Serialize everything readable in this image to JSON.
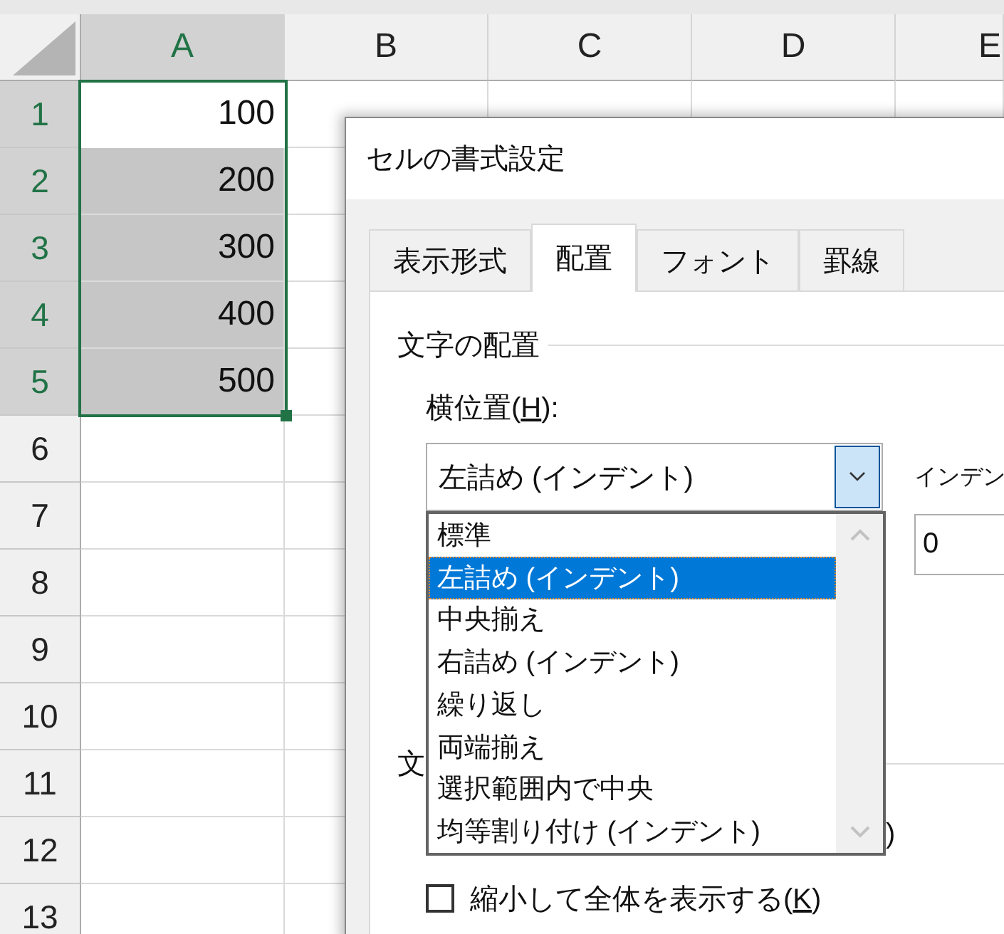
{
  "sheet": {
    "columns": [
      {
        "label": "A",
        "selected": true
      },
      {
        "label": "B",
        "selected": false
      },
      {
        "label": "C",
        "selected": false
      },
      {
        "label": "D",
        "selected": false
      },
      {
        "label": "E",
        "selected": false
      }
    ],
    "rows": [
      {
        "label": "1",
        "selected": true,
        "active": true,
        "cell_a": "100"
      },
      {
        "label": "2",
        "selected": true,
        "active": false,
        "cell_a": "200"
      },
      {
        "label": "3",
        "selected": true,
        "active": false,
        "cell_a": "300"
      },
      {
        "label": "4",
        "selected": true,
        "active": false,
        "cell_a": "400"
      },
      {
        "label": "5",
        "selected": true,
        "active": false,
        "cell_a": "500"
      },
      {
        "label": "6",
        "selected": false
      },
      {
        "label": "7",
        "selected": false
      },
      {
        "label": "8",
        "selected": false
      },
      {
        "label": "9",
        "selected": false
      },
      {
        "label": "10",
        "selected": false
      },
      {
        "label": "11",
        "selected": false
      },
      {
        "label": "12",
        "selected": false
      },
      {
        "label": "13",
        "selected": false
      }
    ]
  },
  "dialog": {
    "title": "セルの書式設定",
    "tabs": [
      {
        "label": "表示形式",
        "selected": false
      },
      {
        "label": "配置",
        "selected": true
      },
      {
        "label": "フォント",
        "selected": false
      },
      {
        "label": "罫線",
        "selected": false
      }
    ],
    "text_alignment": {
      "group_label": "文字の配置",
      "horizontal": {
        "label_before": "横位置(",
        "access_key": "H",
        "label_after": "):",
        "value": "左詰め (インデント)",
        "expanded": true,
        "options": [
          {
            "label": "標準",
            "selected": false
          },
          {
            "label": "左詰め (インデント)",
            "selected": true
          },
          {
            "label": "中央揃え",
            "selected": false
          },
          {
            "label": "右詰め (インデント)",
            "selected": false
          },
          {
            "label": "繰り返し",
            "selected": false
          },
          {
            "label": "両端揃え",
            "selected": false
          },
          {
            "label": "選択範囲内で中央",
            "selected": false
          },
          {
            "label": "均等割り付け (インデント)",
            "selected": false
          }
        ]
      },
      "indent": {
        "label": "インデン",
        "value": "0"
      }
    },
    "group_2_label": "文",
    "covered_fragment": ")",
    "shrink_to_fit": {
      "label_before": "縮小して全体を表示する(",
      "access_key": "K",
      "label_after": ")",
      "checked": false
    }
  }
}
